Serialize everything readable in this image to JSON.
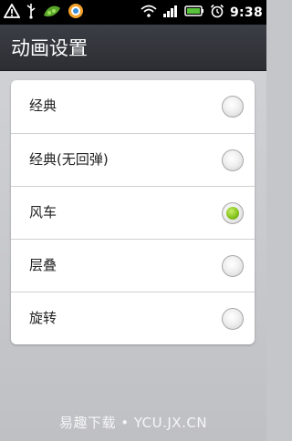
{
  "status_bar": {
    "time": "9:38",
    "left_icons": [
      "warning-icon",
      "usb-icon",
      "pea-icon",
      "browser-icon"
    ],
    "right_icons": [
      "wifi-icon",
      "signal-icon",
      "battery-icon",
      "alarm-icon"
    ]
  },
  "title": "动画设置",
  "options": [
    {
      "label": "经典",
      "selected": false
    },
    {
      "label": "经典(无回弹)",
      "selected": false
    },
    {
      "label": "风车",
      "selected": true
    },
    {
      "label": "层叠",
      "selected": false
    },
    {
      "label": "旋转",
      "selected": false
    }
  ],
  "watermark": "易趣下载 • YCU.JX.CN",
  "colors": {
    "selected_radio": "#86c31c",
    "title_bar": "#33363c"
  }
}
